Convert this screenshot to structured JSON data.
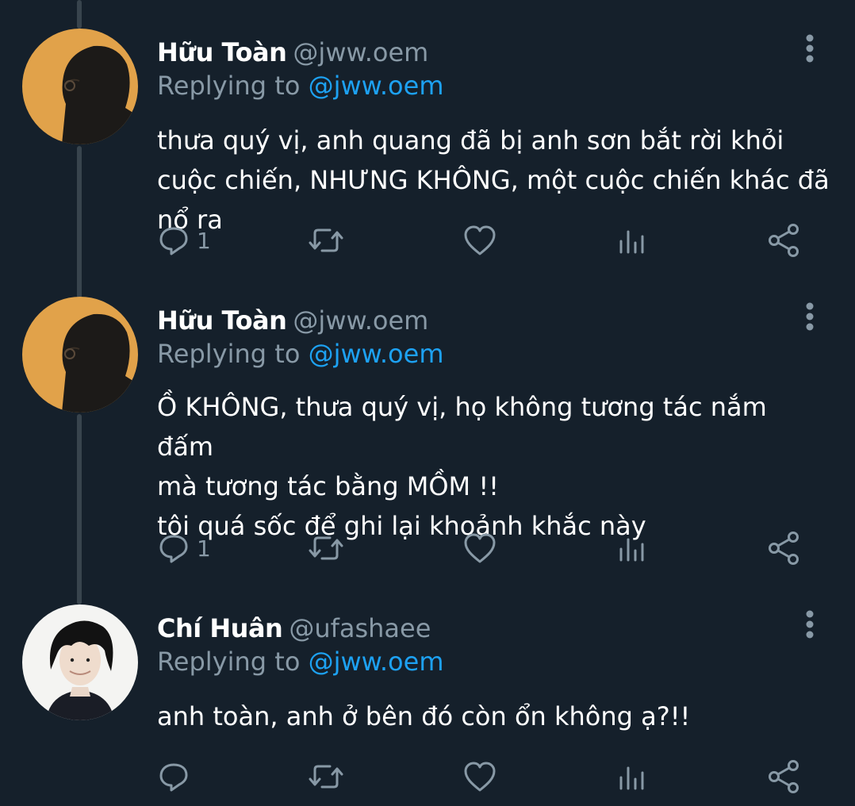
{
  "tweets": [
    {
      "name": "Hữu Toàn",
      "handle": "@jww.oem",
      "replying_prefix": "Replying to",
      "replying_to": "@jww.oem",
      "text": "thưa quý vị, anh quang đã bị anh sơn bắt rời khỏi cuộc chiến, NHƯNG KHÔNG, một cuộc chiến khác đã nổ ra",
      "reply_count": "1",
      "avatar": "dark-silhouette-orange-background"
    },
    {
      "name": "Hữu Toàn",
      "handle": "@jww.oem",
      "replying_prefix": "Replying to",
      "replying_to": "@jww.oem",
      "text": "Ồ KHÔNG, thưa quý vị, họ không tương tác nắm đấm\nmà tương tác bằng MỒM !!\ntôi quá sốc để ghi lại khoảnh khắc này",
      "reply_count": "1",
      "avatar": "dark-silhouette-orange-background"
    },
    {
      "name": "Chí Huân",
      "handle": "@ufashaee",
      "replying_prefix": "Replying to",
      "replying_to": "@jww.oem",
      "text": "anh toàn, anh ở bên đó còn ổn không ạ?!!",
      "reply_count": "",
      "avatar": "person-dark-hair-portrait"
    }
  ],
  "icons": {
    "reply": "reply-icon",
    "retweet": "retweet-icon",
    "like": "heart-icon",
    "analytics": "analytics-icon",
    "share": "share-icon",
    "more": "more-options-icon"
  },
  "colors": {
    "background": "#15202b",
    "text": "#ffffff",
    "secondary": "#8899a6",
    "link": "#1da1f2",
    "thread_line": "#38444d"
  }
}
